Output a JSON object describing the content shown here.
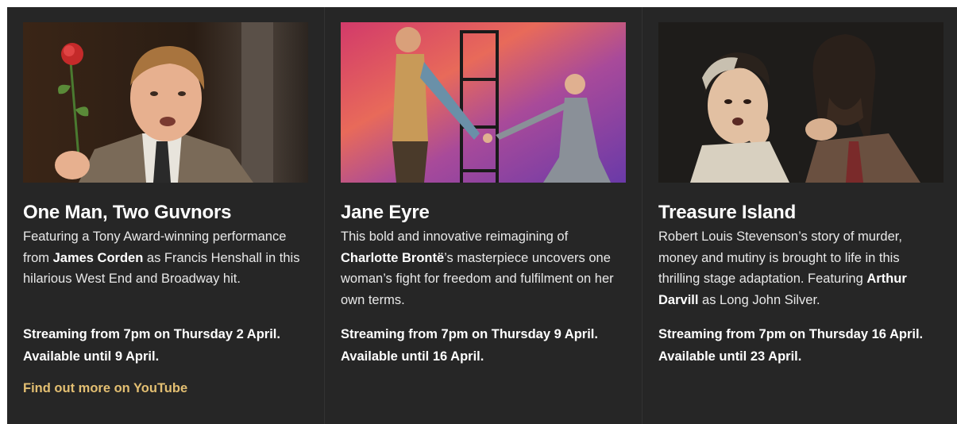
{
  "shows": [
    {
      "title": "One Man, Two Guvnors",
      "desc_parts": [
        "Featuring a Tony Award-winning performance from ",
        "James Corden",
        " as Francis Henshall in this hilarious West End and Broadway hit."
      ],
      "stream_line1": "Streaming from 7pm on Thursday 2 April.",
      "stream_line2": "Available until 9 April.",
      "link_label": "Find out more on YouTube"
    },
    {
      "title": "Jane Eyre",
      "desc_parts": [
        "This bold and innovative reimagining of ",
        "Charlotte Brontë",
        "’s masterpiece uncovers one woman’s fight for freedom and fulfilment on her own terms."
      ],
      "stream_line1": "Streaming from 7pm on Thursday 9 April.",
      "stream_line2": "Available until 16 April."
    },
    {
      "title": "Treasure Island",
      "desc_parts": [
        "Robert Louis Stevenson’s story of murder, money and mutiny is brought to life in this thrilling stage adaptation. Featuring ",
        "Arthur Darvill",
        " as Long John Silver."
      ],
      "stream_line1": "Streaming from 7pm on Thursday 16 April.",
      "stream_line2": "Available until 23 April."
    }
  ],
  "colors": {
    "panel_bg": "#262626",
    "link": "#e3bf72"
  }
}
